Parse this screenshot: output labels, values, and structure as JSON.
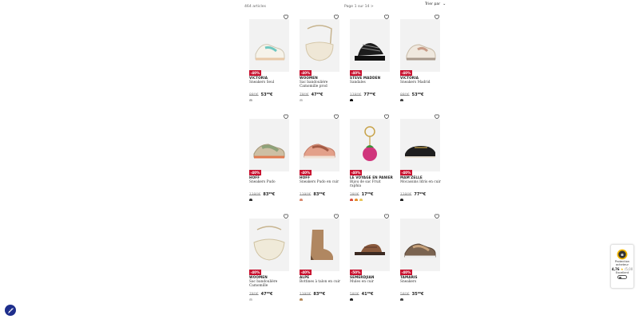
{
  "toolbar": {
    "count": "464 articles",
    "page": "Page 1 sur 14 >",
    "sort_label": "Trier par"
  },
  "products": [
    {
      "badge": "-40%",
      "brand": "VICTORIA",
      "name": "Sneakers Seul",
      "old": "89⁹⁹€",
      "new": "53⁹⁹€",
      "swatches": [
        "#bbbbbb"
      ],
      "icon": "sneaker-mint-icon"
    },
    {
      "badge": "-40%",
      "brand": "WOOMEN",
      "name": "Sac bandoulière Camomille prod",
      "old": "79⁹⁹€",
      "new": "47⁹⁹€",
      "swatches": [
        "#cccccc"
      ],
      "icon": "crossbody-bag-icon"
    },
    {
      "badge": "-40%",
      "brand": "STEVE MADDEN",
      "name": "Sandales",
      "old": "129⁹⁹€",
      "new": "77⁹⁹€",
      "swatches": [
        "#111111"
      ],
      "icon": "chunky-sandal-icon"
    },
    {
      "badge": "-40%",
      "brand": "VICTORIA",
      "name": "Sneakers Madrid",
      "old": "89⁹⁹€",
      "new": "53⁹⁹€",
      "swatches": [
        "#444444"
      ],
      "icon": "sneaker-beige-icon"
    },
    {
      "badge": "-40%",
      "brand": "HOFF",
      "name": "Sneakers Pudo",
      "old": "139⁹⁹€",
      "new": "83⁹⁹€",
      "swatches": [
        "#333333"
      ],
      "icon": "sneaker-green-icon"
    },
    {
      "badge": "-40%",
      "brand": "HOFF",
      "name": "Sneakers Pudo en cuir",
      "old": "139⁹⁹€",
      "new": "83⁹⁹€",
      "swatches": [
        "#d98a6f"
      ],
      "icon": "sneaker-coral-icon"
    },
    {
      "badge": "-40%",
      "brand": "LE VOYAGE EN PANIER",
      "name": "Bijou de sac Fruit raphia",
      "old": "29⁹⁹€",
      "new": "17⁹⁹€",
      "swatches": [
        "#d94b3a",
        "#e38d2c",
        "#e8c55a"
      ],
      "icon": "bag-charm-icon"
    },
    {
      "badge": "-40%",
      "brand": "MAM'ZELLE",
      "name": "Mocassins Idris en cuir",
      "old": "129⁹⁹€",
      "new": "77⁹⁹€",
      "swatches": [
        "#222222"
      ],
      "icon": "loafer-icon"
    },
    {
      "badge": "-40%",
      "brand": "WOOMEN",
      "name": "Sac bandoulière Camomille",
      "old": "79⁹⁹€",
      "new": "47⁹⁹€",
      "swatches": [
        "#cccccc"
      ],
      "icon": "hobo-bag-icon"
    },
    {
      "badge": "-40%",
      "brand": "ALPE",
      "name": "Bottines à talon en cuir",
      "old": "139⁹⁹€",
      "new": "83⁹⁹€",
      "swatches": [
        "#b58a5a"
      ],
      "icon": "ankle-boot-icon"
    },
    {
      "badge": "-50%",
      "brand": "SEMERDJIAN",
      "name": "Mules en cuir",
      "old": "59⁹⁹€",
      "new": "41⁹⁹€",
      "swatches": [
        "#222222"
      ],
      "icon": "mule-icon"
    },
    {
      "badge": "-40%",
      "brand": "TAMARIS",
      "name": "Sneakers",
      "old": "59⁹⁹€",
      "new": "35⁹⁹€",
      "swatches": [
        "#444444"
      ],
      "icon": "sneaker-bronze-icon"
    }
  ],
  "trust": {
    "line1": "Protection",
    "line2": "acheteur",
    "score": "4,76",
    "max": "/5,00",
    "rating_text": "Excellent"
  }
}
